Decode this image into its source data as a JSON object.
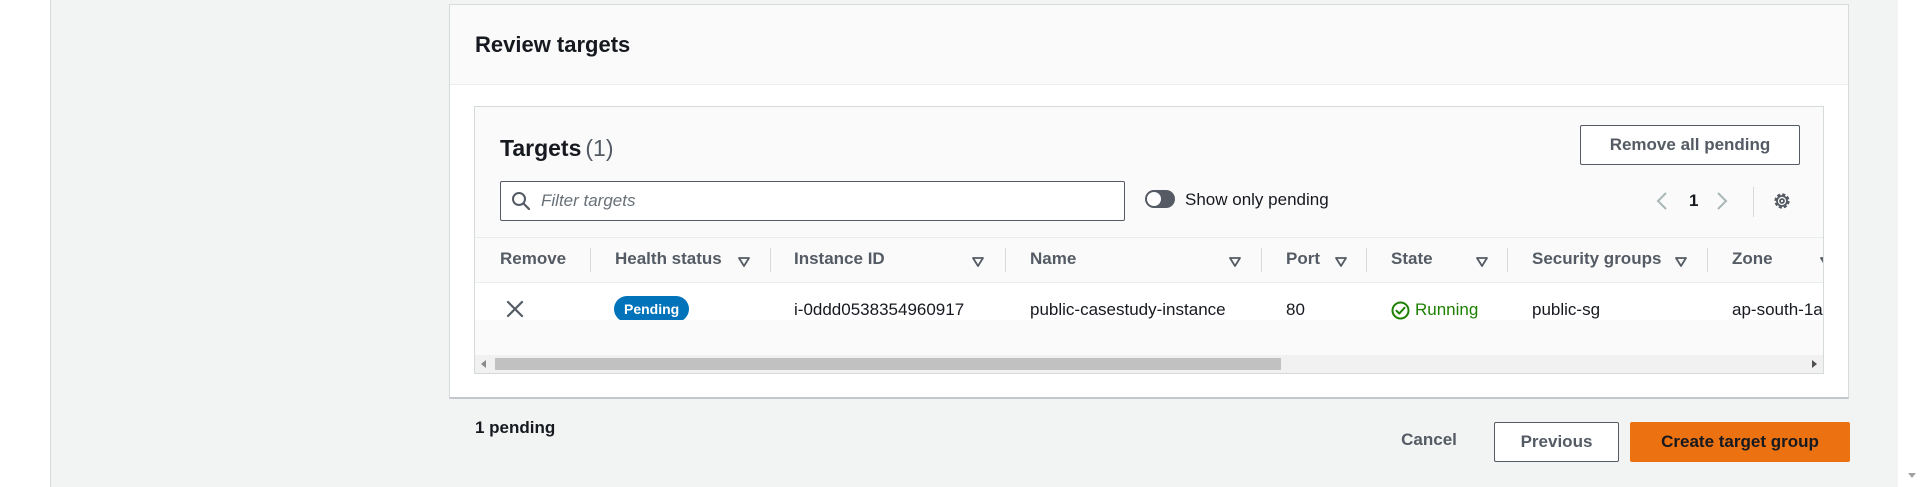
{
  "review": {
    "title": "Review targets"
  },
  "targets": {
    "title": "Targets",
    "count": "(1)",
    "remove_all_label": "Remove all pending",
    "filter_placeholder": "Filter targets",
    "toggle_label": "Show only pending",
    "toggle_on": false,
    "page_number": "1"
  },
  "table": {
    "columns": [
      {
        "label": "Remove",
        "sortable": false
      },
      {
        "label": "Health status",
        "sortable": true
      },
      {
        "label": "Instance ID",
        "sortable": true
      },
      {
        "label": "Name",
        "sortable": true
      },
      {
        "label": "Port",
        "sortable": true
      },
      {
        "label": "State",
        "sortable": true
      },
      {
        "label": "Security groups",
        "sortable": true
      },
      {
        "label": "Zone",
        "sortable": true
      }
    ],
    "rows": [
      {
        "health_status": "Pending",
        "instance_id": "i-0ddd0538354960917",
        "name": "public-casestudy-instance",
        "port": "80",
        "state": "Running",
        "security_groups": "public-sg",
        "zone": "ap-south-1a"
      }
    ]
  },
  "footer": {
    "pending_count": "1 pending",
    "cancel_label": "Cancel",
    "previous_label": "Previous",
    "create_label": "Create target group"
  },
  "colors": {
    "primary_button": "#ec7211",
    "pending_badge": "#0073bb",
    "running_state": "#1d8102",
    "page_background": "#f2f3f3"
  },
  "icons": [
    "search-icon",
    "toggle-switch",
    "chevron-left-icon",
    "chevron-right-icon",
    "gear-icon",
    "sort-down-icon",
    "close-icon",
    "check-circle-icon"
  ]
}
